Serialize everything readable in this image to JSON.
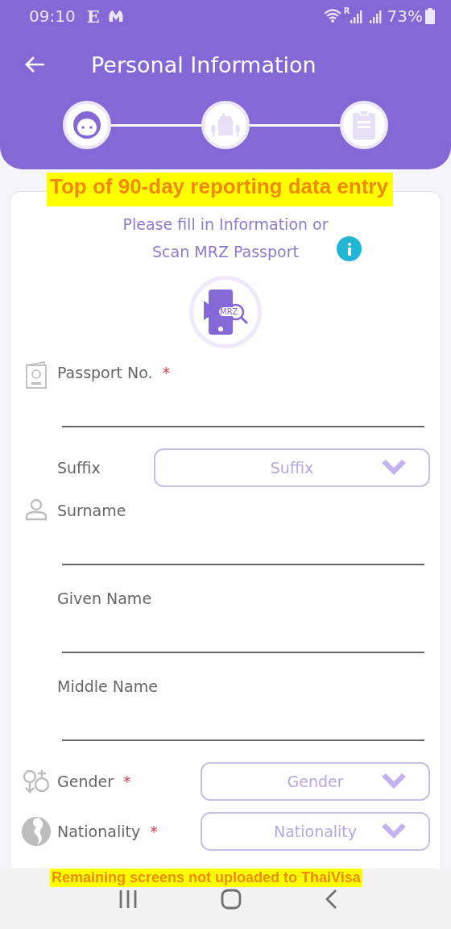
{
  "status_bar": {
    "time": "09:10",
    "notification_glyph": "E",
    "roaming_mark": "R",
    "battery": "73%"
  },
  "header": {
    "title": "Personal Information"
  },
  "steps": [
    {
      "kind": "person",
      "selected": true
    },
    {
      "kind": "house",
      "selected": false
    },
    {
      "kind": "form",
      "selected": false
    }
  ],
  "intro": {
    "lines": [
      "Please fill in Information or",
      "Scan MRZ Passport"
    ],
    "scan_icon_text": "MRZ"
  },
  "fields": [
    {
      "kind": "text",
      "label": "Passport No.",
      "required_mark": "*"
    },
    {
      "kind": "select",
      "label": "Suffix",
      "placeholder": "Suffix"
    },
    {
      "kind": "text",
      "label": "Surname"
    },
    {
      "kind": "text",
      "label": "Given Name"
    },
    {
      "kind": "text",
      "label": "Middle Name"
    },
    {
      "kind": "select",
      "label": "Gender",
      "required_mark": "*",
      "placeholder": "Gender"
    },
    {
      "kind": "select",
      "label": "Nationality",
      "required_mark": "*",
      "placeholder": "Nationality"
    }
  ],
  "annotations": [
    {
      "kind": "top",
      "text": "Top of 90-day reporting data entry"
    },
    {
      "kind": "bottom",
      "text": "Remaining screens not uploaded to ThaiVisa"
    }
  ]
}
